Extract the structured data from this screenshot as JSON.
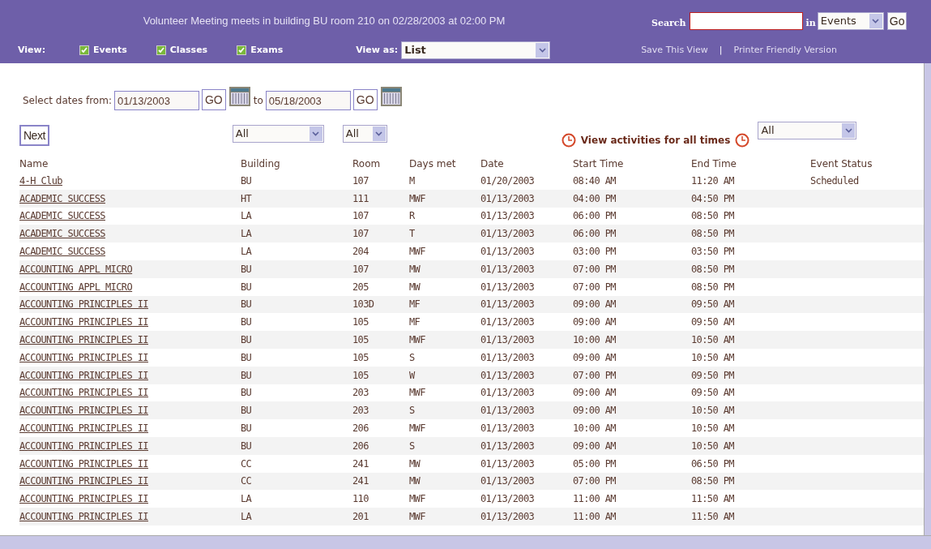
{
  "announcement": "Volunteer Meeting meets in building BU room 210 on  02/28/2003 at 02:00 PM",
  "search": {
    "label": "Search",
    "in_label": "in",
    "scope": "Events",
    "go": "Go"
  },
  "view": {
    "label": "View:",
    "filters": [
      {
        "label": "Events",
        "checked": true
      },
      {
        "label": "Classes",
        "checked": true
      },
      {
        "label": "Exams",
        "checked": true
      }
    ],
    "view_as_label": "View as:",
    "view_as": "List",
    "links": [
      "Save This View",
      "Printer Friendly Version"
    ],
    "separator": "|"
  },
  "dates": {
    "label": "Select dates from:",
    "from": "01/13/2003",
    "go1": "GO",
    "to_label": "to",
    "to": "05/18/2003",
    "go2": "GO"
  },
  "controls": {
    "next": "Next",
    "building_filter": "All",
    "room_filter": "All",
    "all_times_link": "View activities for all times",
    "time_filter": "All"
  },
  "table": {
    "columns": [
      "Name",
      "Building",
      "Room",
      "Days met",
      "Date",
      "Start Time",
      "End Time",
      "Event Status"
    ],
    "rows": [
      [
        "4-H Club",
        "BU",
        "107",
        "M",
        "01/20/2003",
        "08:40 AM",
        "11:20 AM",
        "Scheduled"
      ],
      [
        "ACADEMIC SUCCESS",
        "HT",
        "111",
        "MWF",
        "01/13/2003",
        "04:00 PM",
        "04:50 PM",
        ""
      ],
      [
        "ACADEMIC SUCCESS",
        "LA",
        "107",
        "R",
        "01/13/2003",
        "06:00 PM",
        "08:50 PM",
        ""
      ],
      [
        "ACADEMIC SUCCESS",
        "LA",
        "107",
        "T",
        "01/13/2003",
        "06:00 PM",
        "08:50 PM",
        ""
      ],
      [
        "ACADEMIC SUCCESS",
        "LA",
        "204",
        "MWF",
        "01/13/2003",
        "03:00 PM",
        "03:50 PM",
        ""
      ],
      [
        "ACCOUNTING APPL MICRO",
        "BU",
        "107",
        "MW",
        "01/13/2003",
        "07:00 PM",
        "08:50 PM",
        ""
      ],
      [
        "ACCOUNTING APPL MICRO",
        "BU",
        "205",
        "MW",
        "01/13/2003",
        "07:00 PM",
        "08:50 PM",
        ""
      ],
      [
        "ACCOUNTING PRINCIPLES II",
        "BU",
        "103D",
        "MF",
        "01/13/2003",
        "09:00 AM",
        "09:50 AM",
        ""
      ],
      [
        "ACCOUNTING PRINCIPLES II",
        "BU",
        "105",
        "MF",
        "01/13/2003",
        "09:00 AM",
        "09:50 AM",
        ""
      ],
      [
        "ACCOUNTING PRINCIPLES II",
        "BU",
        "105",
        "MWF",
        "01/13/2003",
        "10:00 AM",
        "10:50 AM",
        ""
      ],
      [
        "ACCOUNTING PRINCIPLES II",
        "BU",
        "105",
        "S",
        "01/13/2003",
        "09:00 AM",
        "10:50 AM",
        ""
      ],
      [
        "ACCOUNTING PRINCIPLES II",
        "BU",
        "105",
        "W",
        "01/13/2003",
        "07:00 PM",
        "09:50 PM",
        ""
      ],
      [
        "ACCOUNTING PRINCIPLES II",
        "BU",
        "203",
        "MWF",
        "01/13/2003",
        "09:00 AM",
        "09:50 AM",
        ""
      ],
      [
        "ACCOUNTING PRINCIPLES II",
        "BU",
        "203",
        "S",
        "01/13/2003",
        "09:00 AM",
        "10:50 AM",
        ""
      ],
      [
        "ACCOUNTING PRINCIPLES II",
        "BU",
        "206",
        "MWF",
        "01/13/2003",
        "10:00 AM",
        "10:50 AM",
        ""
      ],
      [
        "ACCOUNTING PRINCIPLES II",
        "BU",
        "206",
        "S",
        "01/13/2003",
        "09:00 AM",
        "10:50 AM",
        ""
      ],
      [
        "ACCOUNTING PRINCIPLES II",
        "CC",
        "241",
        "MW",
        "01/13/2003",
        "05:00 PM",
        "06:50 PM",
        ""
      ],
      [
        "ACCOUNTING PRINCIPLES II",
        "CC",
        "241",
        "MW",
        "01/13/2003",
        "07:00 PM",
        "08:50 PM",
        ""
      ],
      [
        "ACCOUNTING PRINCIPLES II",
        "LA",
        "110",
        "MWF",
        "01/13/2003",
        "11:00 AM",
        "11:50 AM",
        ""
      ],
      [
        "ACCOUNTING PRINCIPLES II",
        "LA",
        "201",
        "MWF",
        "01/13/2003",
        "11:00 AM",
        "11:50 AM",
        ""
      ]
    ]
  }
}
